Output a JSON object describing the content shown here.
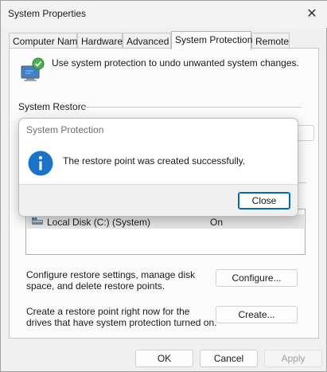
{
  "window": {
    "title": "System Properties",
    "close_glyph": "✕"
  },
  "tabs": [
    {
      "label": "Computer Name",
      "active": false
    },
    {
      "label": "Hardware",
      "active": false
    },
    {
      "label": "Advanced",
      "active": false
    },
    {
      "label": "System Protection",
      "active": true
    },
    {
      "label": "Remote",
      "active": false
    }
  ],
  "panel": {
    "intro": "Use system protection to undo unwanted system changes.",
    "section_system_restore": "System Restore",
    "drives": [
      {
        "name": "Local Disk (C:) (System)",
        "protection": "On",
        "icon": "drive-icon"
      }
    ],
    "configure_text": "Configure restore settings, manage disk space, and delete restore points.",
    "configure_button": "Configure...",
    "create_text": "Create a restore point right now for the drives that have system protection turned on.",
    "create_button": "Create..."
  },
  "footer": {
    "ok": "OK",
    "cancel": "Cancel",
    "apply": "Apply",
    "apply_enabled": false
  },
  "dialog": {
    "title": "System Protection",
    "icon": "info-icon",
    "message": "The restore point was created successfully.",
    "close_button": "Close"
  },
  "colors": {
    "accent": "#0067c0",
    "info_icon": "#1a73c9",
    "row_highlight": "#e5e5e5"
  }
}
